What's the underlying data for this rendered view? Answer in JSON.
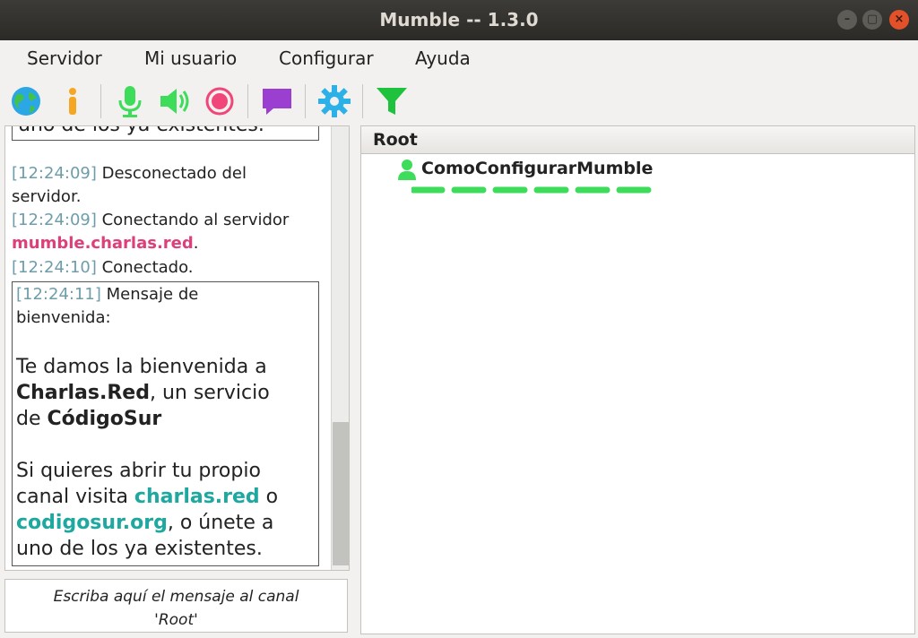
{
  "window": {
    "title": "Mumble -- 1.3.0"
  },
  "menu": {
    "items": [
      {
        "label": "Servidor"
      },
      {
        "label": "Mi usuario"
      },
      {
        "label": "Configurar"
      },
      {
        "label": "Ayuda"
      }
    ]
  },
  "toolbar": {
    "icons": [
      "globe-icon",
      "info-icon",
      "microphone-icon",
      "speaker-icon",
      "record-icon",
      "comment-icon",
      "settings-gear-icon",
      "filter-icon"
    ]
  },
  "chat": {
    "prev_fragment": "uno de los ya existentes.",
    "log": [
      {
        "ts": "[12:24:09]",
        "text": " Desconectado del",
        "cont": "servidor."
      },
      {
        "ts": "[12:24:09]",
        "text": " Conectando al servidor",
        "link": "mumble.charlas.red",
        "after": "."
      },
      {
        "ts": "[12:24:10]",
        "text": " Conectado."
      }
    ],
    "welcome": {
      "ts": "[12:24:11]",
      "head1": " Mensaje de",
      "head2": "bienvenida:",
      "p1_l1": "Te damos la bienvenida a",
      "p1_bold1": "Charlas.Red",
      "p1_rest1": ", un servicio",
      "p1_pre2": "de ",
      "p1_bold2": "CódigoSur",
      "p2_l1": "Si quieres abrir tu propio",
      "p2_pre2": "canal visita ",
      "p2_link1": "charlas.red",
      "p2_post2": " o",
      "p2_link2": "codigosur.org",
      "p2_post3": ", o únete a",
      "p2_l4": "uno de los ya existentes."
    },
    "input_placeholder_l1": "Escriba aquí el mensaje al canal",
    "input_placeholder_l2": "'Root'"
  },
  "tree": {
    "header": "Root",
    "users": [
      {
        "name": "ComoConfigurarMumble"
      }
    ]
  },
  "colors": {
    "ts": "#6e9daa",
    "magenta": "#de3f7a",
    "teal": "#1ea8a0",
    "green": "#3ddc5a",
    "orange": "#f5a623",
    "pink": "#f0467a",
    "purple": "#9b3fd1",
    "blue": "#2bb0e8"
  }
}
